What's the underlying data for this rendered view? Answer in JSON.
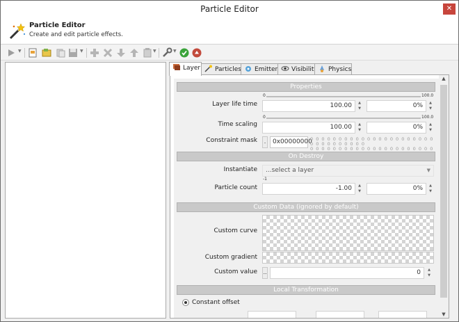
{
  "window": {
    "title": "Particle Editor",
    "close_glyph": "✕"
  },
  "header": {
    "title": "Particle Editor",
    "subtitle": "Create and edit particle effects.",
    "icon": "magic-wand-icon"
  },
  "toolbar": {
    "icons": [
      "play-icon",
      "new-layer-icon",
      "open-folder-icon",
      "copy-icon",
      "save-icon",
      "add-icon",
      "delete-icon",
      "move-down-icon",
      "move-up-icon",
      "paste-icon",
      "wrench-icon",
      "ok-icon",
      "cancel-icon"
    ]
  },
  "tabs": [
    {
      "label": "Layer",
      "icon": "layer-icon",
      "active": true
    },
    {
      "label": "Particles",
      "icon": "particles-icon"
    },
    {
      "label": "Emitter",
      "icon": "emitter-icon"
    },
    {
      "label": "Visibility",
      "icon": "eye-icon"
    },
    {
      "label": "Physics",
      "icon": "physics-icon"
    }
  ],
  "sections": {
    "properties": "Properties",
    "on_destroy": "On Destroy",
    "custom_data": "Custom Data (ignored by default)",
    "local_transformation": "Local Transformation"
  },
  "fields": {
    "layer_life_time": {
      "label": "Layer life time",
      "value": "100.00",
      "variation": "0%",
      "slider_min": "0",
      "slider_max": "100.0"
    },
    "time_scaling": {
      "label": "Time scaling",
      "value": "100.00",
      "variation": "0%",
      "slider_min": "0",
      "slider_max": "100.0"
    },
    "constraint_mask": {
      "label": "Constraint mask",
      "button": ".",
      "value": "0x00000000"
    },
    "instantiate": {
      "label": "Instantiate",
      "value": "...select a layer"
    },
    "particle_count": {
      "label": "Particle count",
      "value": "-1.00",
      "variation": "0%",
      "tick": "-1"
    },
    "custom_curve": {
      "label": "Custom curve"
    },
    "custom_gradient": {
      "label": "Custom gradient"
    },
    "custom_value": {
      "label": "Custom value",
      "button": "..",
      "value": "0"
    },
    "constant_offset": {
      "label": "Constant offset"
    }
  },
  "colors": {
    "section_bg": "#c9c9c9",
    "close_bg": "#c7453c"
  }
}
